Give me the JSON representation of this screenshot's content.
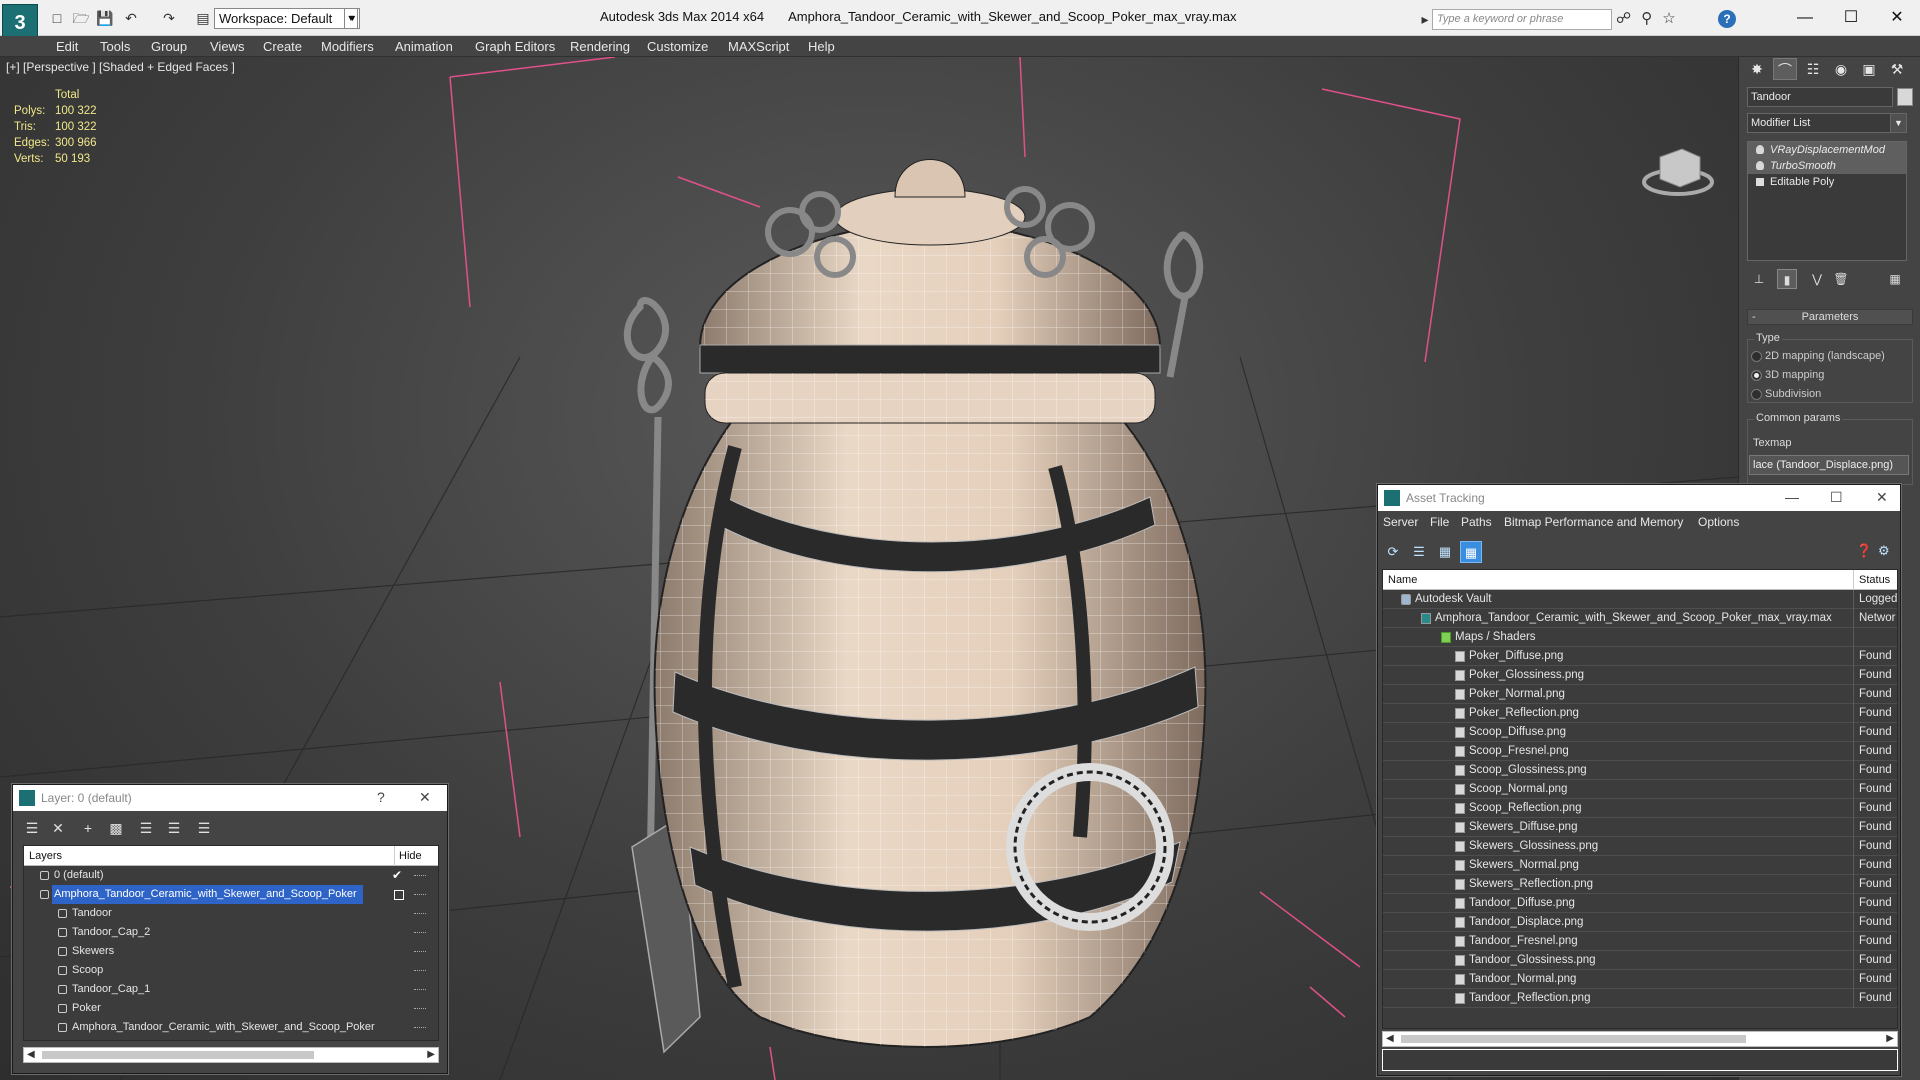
{
  "app": {
    "title": "Autodesk 3ds Max  2014 x64",
    "filename": "Amphora_Tandoor_Ceramic_with_Skewer_and_Scoop_Poker_max_vray.max",
    "workspace": "Workspace: Default",
    "search_placeholder": "Type a keyword or phrase",
    "help_icon": "?"
  },
  "menu": [
    "Edit",
    "Tools",
    "Group",
    "Views",
    "Create",
    "Modifiers",
    "Animation",
    "Graph Editors",
    "Rendering",
    "Customize",
    "MAXScript",
    "Help"
  ],
  "viewport": {
    "label": "[+] [Perspective ] [Shaded + Edged Faces ]",
    "stats": {
      "header": "Total",
      "rows": [
        {
          "k": "Polys:",
          "v": "100 322"
        },
        {
          "k": "Tris:",
          "v": "100 322"
        },
        {
          "k": "Edges:",
          "v": "300 966"
        },
        {
          "k": "Verts:",
          "v": "50 193"
        }
      ]
    }
  },
  "command_panel": {
    "object_name": "Tandoor",
    "modifier_list": "Modifier List",
    "stack": [
      {
        "label": "VRayDisplacementMod",
        "type": "modifier"
      },
      {
        "label": "TurboSmooth",
        "type": "modifier"
      },
      {
        "label": "Editable Poly",
        "type": "base"
      }
    ],
    "parameters_title": "Parameters",
    "type_group": "Type",
    "type_options": [
      {
        "label": "2D mapping (landscape)",
        "selected": false
      },
      {
        "label": "3D mapping",
        "selected": true
      },
      {
        "label": "Subdivision",
        "selected": false
      }
    ],
    "common_params": "Common params",
    "texmap_label": "Texmap",
    "texmap_value": "lace (Tandoor_Displace.png)"
  },
  "layer_dialog": {
    "title": "Layer: 0 (default)",
    "help": "?",
    "col_layers": "Layers",
    "col_hide": "Hide",
    "rows": [
      {
        "name": "0 (default)",
        "level": 0,
        "checked": true,
        "selected": false
      },
      {
        "name": "Amphora_Tandoor_Ceramic_with_Skewer_and_Scoop_Poker",
        "level": 0,
        "checked": false,
        "selected": true
      },
      {
        "name": "Tandoor",
        "level": 1
      },
      {
        "name": "Tandoor_Cap_2",
        "level": 1
      },
      {
        "name": "Skewers",
        "level": 1
      },
      {
        "name": "Scoop",
        "level": 1
      },
      {
        "name": "Tandoor_Cap_1",
        "level": 1
      },
      {
        "name": "Poker",
        "level": 1
      },
      {
        "name": "Amphora_Tandoor_Ceramic_with_Skewer_and_Scoop_Poker",
        "level": 1
      }
    ]
  },
  "asset_tracking": {
    "title": "Asset Tracking",
    "menu": [
      "Server",
      "File",
      "Paths",
      "Bitmap Performance and Memory",
      "Options"
    ],
    "col_name": "Name",
    "col_status": "Status",
    "rows": [
      {
        "name": "Autodesk Vault",
        "level": 0,
        "icon": "vault",
        "status": "Logged"
      },
      {
        "name": "Amphora_Tandoor_Ceramic_with_Skewer_and_Scoop_Poker_max_vray.max",
        "level": 1,
        "icon": "max",
        "status": "Networ"
      },
      {
        "name": "Maps / Shaders",
        "level": 2,
        "icon": "folder",
        "status": ""
      },
      {
        "name": "Poker_Diffuse.png",
        "level": 3,
        "icon": "file",
        "status": "Found"
      },
      {
        "name": "Poker_Glossiness.png",
        "level": 3,
        "icon": "file",
        "status": "Found"
      },
      {
        "name": "Poker_Normal.png",
        "level": 3,
        "icon": "file",
        "status": "Found"
      },
      {
        "name": "Poker_Reflection.png",
        "level": 3,
        "icon": "file",
        "status": "Found"
      },
      {
        "name": "Scoop_Diffuse.png",
        "level": 3,
        "icon": "file",
        "status": "Found"
      },
      {
        "name": "Scoop_Fresnel.png",
        "level": 3,
        "icon": "file",
        "status": "Found"
      },
      {
        "name": "Scoop_Glossiness.png",
        "level": 3,
        "icon": "file",
        "status": "Found"
      },
      {
        "name": "Scoop_Normal.png",
        "level": 3,
        "icon": "file",
        "status": "Found"
      },
      {
        "name": "Scoop_Reflection.png",
        "level": 3,
        "icon": "file",
        "status": "Found"
      },
      {
        "name": "Skewers_Diffuse.png",
        "level": 3,
        "icon": "file",
        "status": "Found"
      },
      {
        "name": "Skewers_Glossiness.png",
        "level": 3,
        "icon": "file",
        "status": "Found"
      },
      {
        "name": "Skewers_Normal.png",
        "level": 3,
        "icon": "file",
        "status": "Found"
      },
      {
        "name": "Skewers_Reflection.png",
        "level": 3,
        "icon": "file",
        "status": "Found"
      },
      {
        "name": "Tandoor_Diffuse.png",
        "level": 3,
        "icon": "file",
        "status": "Found"
      },
      {
        "name": "Tandoor_Displace.png",
        "level": 3,
        "icon": "file",
        "status": "Found"
      },
      {
        "name": "Tandoor_Fresnel.png",
        "level": 3,
        "icon": "file",
        "status": "Found"
      },
      {
        "name": "Tandoor_Glossiness.png",
        "level": 3,
        "icon": "file",
        "status": "Found"
      },
      {
        "name": "Tandoor_Normal.png",
        "level": 3,
        "icon": "file",
        "status": "Found"
      },
      {
        "name": "Tandoor_Reflection.png",
        "level": 3,
        "icon": "file",
        "status": "Found"
      }
    ]
  },
  "colors": {
    "stats_text": "#f0e88a",
    "selection": "#2e64c8",
    "app_accent": "#1c6f72",
    "bounding_box": "#e0508a"
  }
}
